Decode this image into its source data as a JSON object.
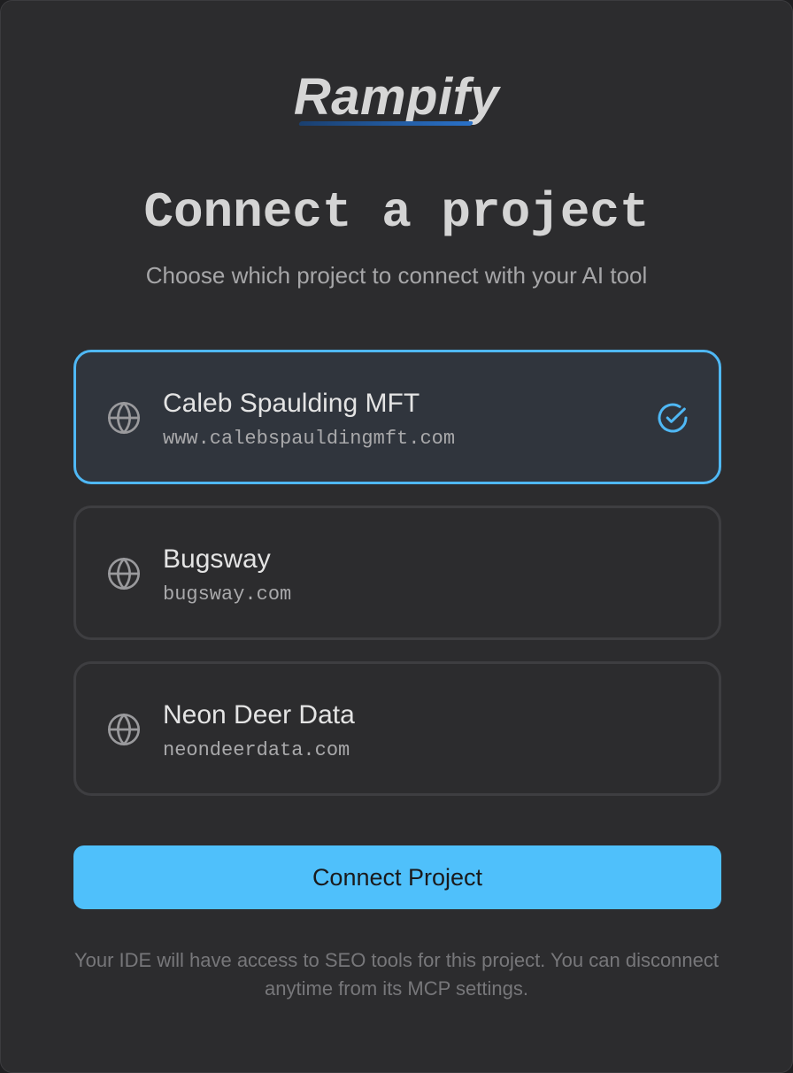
{
  "brand": {
    "logo_text": "Rampify"
  },
  "header": {
    "title": "Connect a project",
    "subtitle": "Choose which project to connect with your AI tool"
  },
  "projects": [
    {
      "name": "Caleb Spaulding MFT",
      "url": "www.calebspauldingmft.com",
      "selected": true
    },
    {
      "name": "Bugsway",
      "url": "bugsway.com",
      "selected": false
    },
    {
      "name": "Neon Deer Data",
      "url": "neondeerdata.com",
      "selected": false
    }
  ],
  "icons": {
    "project": "globe-icon",
    "selected": "check-circle-icon"
  },
  "actions": {
    "connect_label": "Connect Project"
  },
  "footer": {
    "note": "Your IDE will have access to SEO tools for this project. You can disconnect anytime from its MCP settings."
  },
  "colors": {
    "accent": "#4fc0fb",
    "selected_border": "#4fb8f5",
    "background": "#2c2c2e"
  }
}
